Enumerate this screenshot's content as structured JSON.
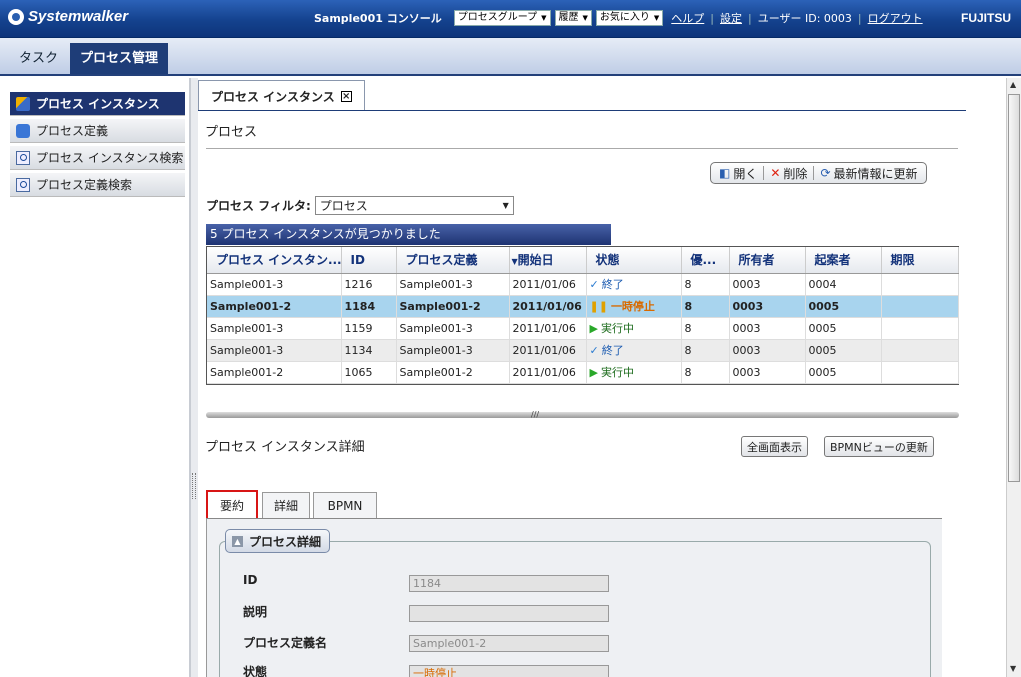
{
  "header": {
    "logo": "Systemwalker",
    "console": "Sample001 コンソール",
    "dropdowns": [
      "プロセスグループ",
      "履歴",
      "お気に入り"
    ],
    "help": "ヘルプ",
    "settings": "設定",
    "user": "ユーザー ID: 0003",
    "logout": "ログアウト",
    "brand": "FUJITSU"
  },
  "main_tabs": [
    "タスク",
    "プロセス管理"
  ],
  "sidebar": {
    "items": [
      "プロセス インスタンス",
      "プロセス定義",
      "プロセス インスタンス検索",
      "プロセス定義検索"
    ]
  },
  "content": {
    "tab_label": "プロセス インスタンス",
    "section_title": "プロセス",
    "toolbar": {
      "open": "開く",
      "delete": "削除",
      "refresh": "最新情報に更新"
    },
    "filter_label": "プロセス フィルタ:",
    "filter_value": "プロセス",
    "found_text": "5 プロセス インスタンスが見つかりました",
    "columns": [
      "プロセス インスタン...",
      "ID",
      "プロセス定義",
      "開始日",
      "状態",
      "優...",
      "所有者",
      "起案者",
      "期限"
    ],
    "rows": [
      {
        "name": "Sample001-3",
        "id": "1216",
        "def": "Sample001-3",
        "date": "2011/01/06",
        "status": "終了",
        "prio": "8",
        "owner": "0003",
        "drafter": "0004",
        "due": ""
      },
      {
        "name": "Sample001-2",
        "id": "1184",
        "def": "Sample001-2",
        "date": "2011/01/06",
        "status": "一時停止",
        "prio": "8",
        "owner": "0003",
        "drafter": "0005",
        "due": ""
      },
      {
        "name": "Sample001-3",
        "id": "1159",
        "def": "Sample001-3",
        "date": "2011/01/06",
        "status": "実行中",
        "prio": "8",
        "owner": "0003",
        "drafter": "0005",
        "due": ""
      },
      {
        "name": "Sample001-3",
        "id": "1134",
        "def": "Sample001-3",
        "date": "2011/01/06",
        "status": "終了",
        "prio": "8",
        "owner": "0003",
        "drafter": "0005",
        "due": ""
      },
      {
        "name": "Sample001-2",
        "id": "1065",
        "def": "Sample001-2",
        "date": "2011/01/06",
        "status": "実行中",
        "prio": "8",
        "owner": "0003",
        "drafter": "0005",
        "due": ""
      }
    ],
    "details_title": "プロセス インスタンス詳細",
    "fullscreen_btn": "全画面表示",
    "bpmn_refresh_btn": "BPMNビューの更新",
    "detail_tabs": [
      "要約",
      "詳細",
      "BPMN"
    ],
    "fieldset_legend": "プロセス詳細",
    "fields": [
      {
        "label": "ID",
        "value": "1184"
      },
      {
        "label": "説明",
        "value": ""
      },
      {
        "label": "プロセス定義名",
        "value": "Sample001-2"
      },
      {
        "label": "状態",
        "value": "一時停止"
      }
    ]
  }
}
